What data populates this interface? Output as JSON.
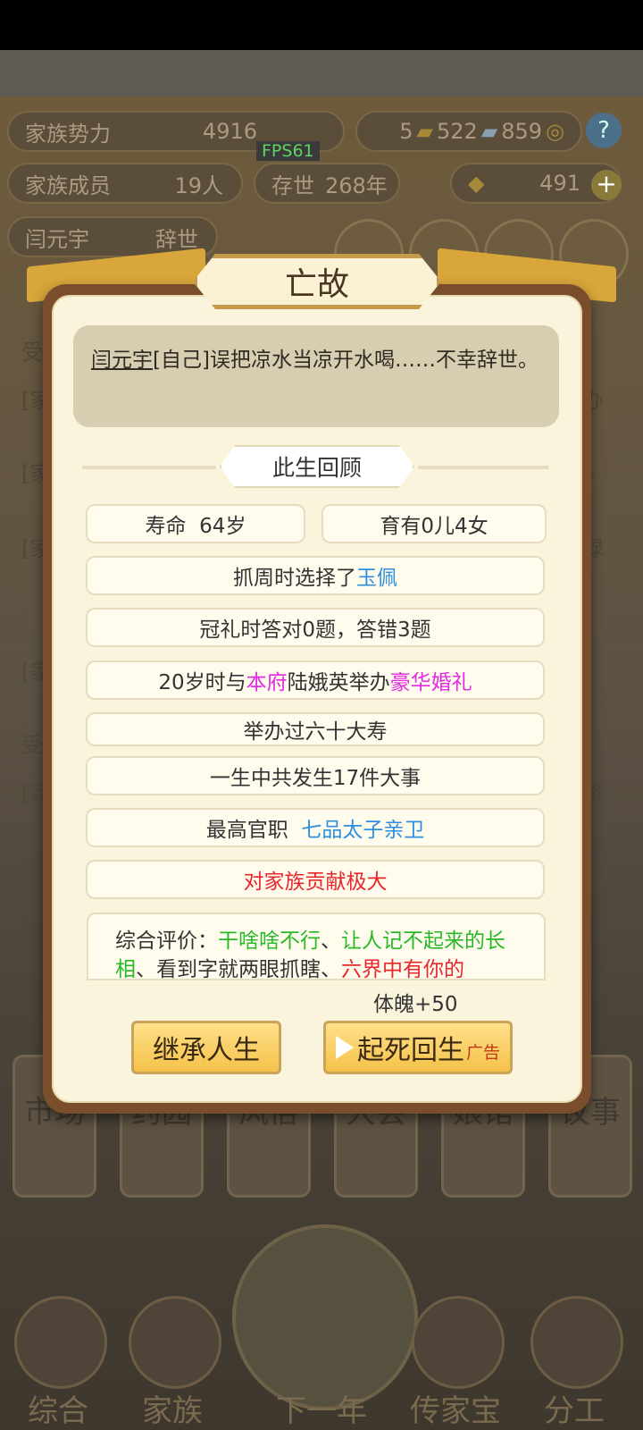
{
  "top": {
    "family_power_label": "家族势力",
    "family_power_value": "4916",
    "fps": "FPS61",
    "resources": [
      "5",
      "522",
      "859"
    ],
    "members_label": "家族成员",
    "members_value": "19人",
    "existence_label": "存世",
    "existence_value": "268年",
    "gold": "491",
    "char_name": "闫元宇",
    "char_status": "辞世"
  },
  "dialog": {
    "title": "亡故",
    "message_name": "闫元宇",
    "message_rest": "[自己]误把凉水当凉开水喝……不幸辞世。",
    "section": "此生回顾",
    "life_label": "寿命",
    "life_value": "64岁",
    "children": "育有0儿4女",
    "zhuazhou_prefix": "抓周时选择了",
    "zhuazhou_item": "玉佩",
    "guanli": "冠礼时答对0题，答错3题",
    "wedding_prefix": "20岁时与",
    "wedding_house": "本府",
    "wedding_mid": "陆娥英举办",
    "wedding_type": "豪华婚礼",
    "birthday": "举办过六十大寿",
    "events": "一生中共发生17件大事",
    "office_label": "最高官职",
    "office_value": "七品太子亲卫",
    "contribution": "对家族贡献极大",
    "eval_label": "综合评价：",
    "eval_t1": "干啥啥不行",
    "eval_sep1": "、",
    "eval_t2": "让人记不起来的长相",
    "eval_sep2": "、看到字就两眼抓瞎、",
    "eval_t3": "六界中有你的",
    "reward": "体魄+50",
    "inherit_btn": "继承人生",
    "revive_btn": "起死回生",
    "ad_tag": "广告"
  },
  "background": {
    "left_fragments": [
      "受",
      "[家",
      "[家",
      "[家",
      "[家",
      "受",
      "[家",
      "[家"
    ],
    "right_fragments": [
      "办",
      "1",
      "禄",
      "]",
      "将"
    ],
    "grid_buttons": [
      "市场",
      "药园",
      "风俗",
      "大会",
      "娘馆",
      "议事"
    ],
    "nav": [
      "综合",
      "家族",
      "下一年",
      "传家宝",
      "分工"
    ]
  }
}
